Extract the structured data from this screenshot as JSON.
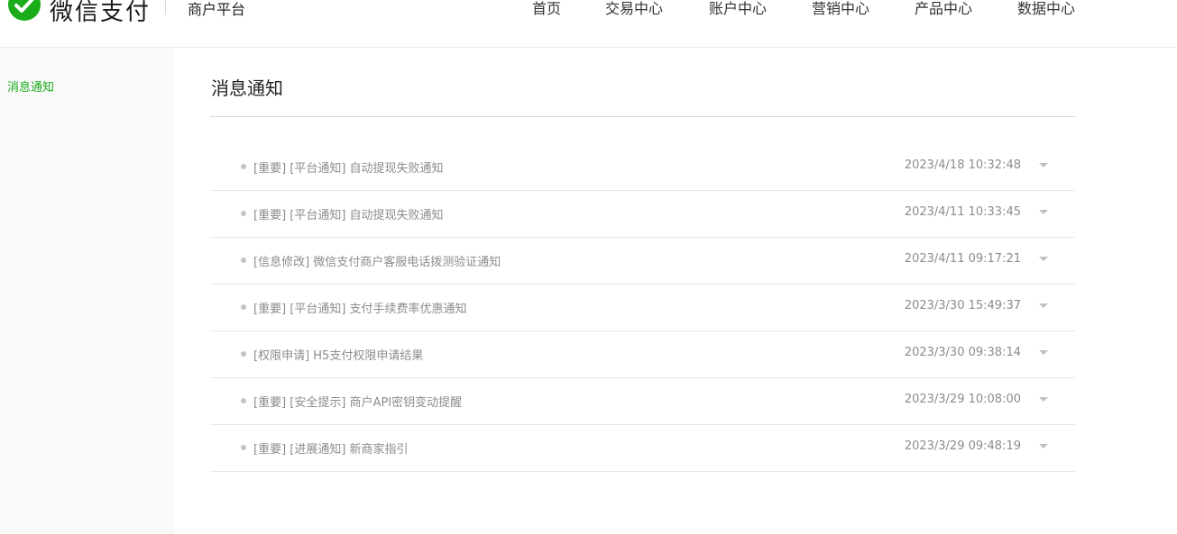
{
  "header": {
    "logo_text": "微信支付",
    "platform": "商户平台",
    "nav": [
      "首页",
      "交易中心",
      "账户中心",
      "营销中心",
      "产品中心",
      "数据中心"
    ],
    "brand_color": "#1aad19"
  },
  "sidebar": {
    "items": [
      {
        "label": "消息通知",
        "active": true
      }
    ]
  },
  "main": {
    "title": "消息通知",
    "messages": [
      {
        "subject": "[重要] [平台通知] 自动提现失败通知",
        "time": "2023/4/18 10:32:48"
      },
      {
        "subject": "[重要] [平台通知] 自动提现失败通知",
        "time": "2023/4/11 10:33:45"
      },
      {
        "subject": "[信息修改] 微信支付商户客服电话拨测验证通知",
        "time": "2023/4/11 09:17:21"
      },
      {
        "subject": "[重要] [平台通知] 支付手续费率优惠通知",
        "time": "2023/3/30 15:49:37"
      },
      {
        "subject": "[权限申请] H5支付权限申请结果",
        "time": "2023/3/30 09:38:14"
      },
      {
        "subject": "[重要] [安全提示] 商户API密钥变动提醒",
        "time": "2023/3/29 10:08:00"
      },
      {
        "subject": "[重要] [进展通知] 新商家指引",
        "time": "2023/3/29 09:48:19"
      }
    ]
  }
}
